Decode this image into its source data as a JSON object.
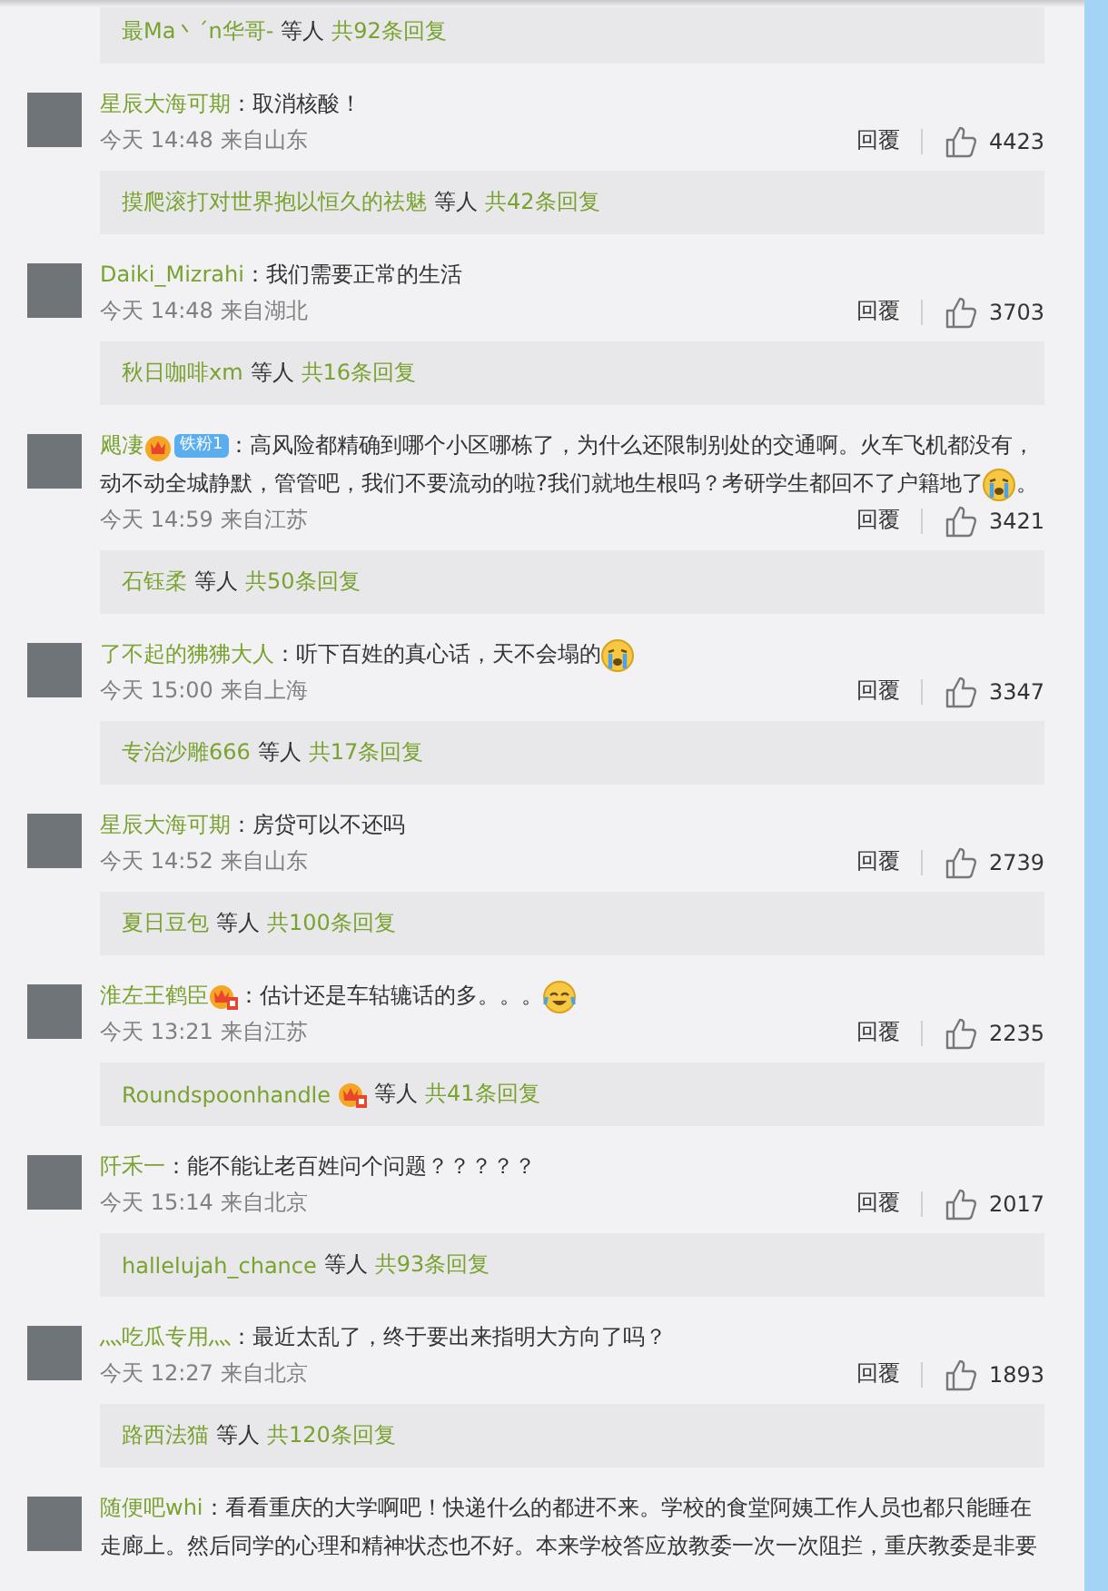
{
  "top_replies": {
    "names": "最Ma丶ˊn华哥-",
    "suffix": "等人",
    "count": "共92条回复"
  },
  "comments": [
    {
      "user": "星辰大海可期",
      "text": "：取消核酸！",
      "time": "今天 14:48",
      "source": "来自山东",
      "reply_label": "回覆",
      "likes": "4423",
      "replies": {
        "names": "摸爬滚打对世界抱以恒久的祛魅",
        "suffix": "等人",
        "count": "共42条回复"
      }
    },
    {
      "user": "Daiki_Mizrahi",
      "text": "：我们需要正常的生活",
      "time": "今天 14:48",
      "source": "来自湖北",
      "reply_label": "回覆",
      "likes": "3703",
      "replies": {
        "names": "秋日咖啡xm",
        "suffix": "等人",
        "count": "共16条回复"
      }
    },
    {
      "user": "飓凄",
      "badges": [
        {
          "kind": "crown"
        },
        {
          "kind": "fan",
          "label": "铁粉1"
        }
      ],
      "text": "：高风险都精确到哪个小区哪栋了，为什么还限制别处的交通啊。火车飞机都没有，",
      "more_lines": [
        "动不动全城静默，管管吧，我们不要流动的啦?我们就地生根吗？考研学生都回不了户籍地了"
      ],
      "emoji": {
        "kind": "crying"
      },
      "tail": "。",
      "time": "今天 14:59",
      "source": "来自江苏",
      "reply_label": "回覆",
      "likes": "3421",
      "replies": {
        "names": "石钰柔",
        "suffix": "等人",
        "count": "共50条回复"
      }
    },
    {
      "user": "了不起的狒狒大人",
      "text": "：听下百姓的真心话，天不会塌的",
      "emoji": {
        "kind": "crying"
      },
      "time": "今天 15:00",
      "source": "来自上海",
      "reply_label": "回覆",
      "likes": "3347",
      "replies": {
        "names": "专治沙雕666",
        "suffix": "等人",
        "count": "共17条回复"
      }
    },
    {
      "user": "星辰大海可期",
      "text": "：房贷可以不还吗",
      "time": "今天 14:52",
      "source": "来自山东",
      "reply_label": "回覆",
      "likes": "2739",
      "replies": {
        "names": "夏日豆包",
        "suffix": "等人",
        "count": "共100条回复"
      }
    },
    {
      "user": "淮左王鹤臣",
      "badges": [
        {
          "kind": "crown-tag"
        }
      ],
      "text": "：估计还是车轱辘话的多。。。",
      "emoji": {
        "kind": "laughing-crying"
      },
      "time": "今天 13:21",
      "source": "来自江苏",
      "reply_label": "回覆",
      "likes": "2235",
      "replies": {
        "names": "Roundspoonhandle",
        "badges": [
          {
            "kind": "crown-tag"
          }
        ],
        "suffix": "等人",
        "count": "共41条回复"
      }
    },
    {
      "user": "阡禾一",
      "text": "：能不能让老百姓问个问题？？？？？",
      "time": "今天 15:14",
      "source": "来自北京",
      "reply_label": "回覆",
      "likes": "2017",
      "replies": {
        "names": "hallelujah_chance",
        "suffix": "等人",
        "count": "共93条回复"
      }
    },
    {
      "user": "灬吃瓜专用灬",
      "text": "：最近太乱了，终于要出来指明大方向了吗？",
      "time": "今天 12:27",
      "source": "来自北京",
      "reply_label": "回覆",
      "likes": "1893",
      "replies": {
        "names": "路西法猫",
        "suffix": "等人",
        "count": "共120条回复"
      }
    },
    {
      "user": "随便吧whi",
      "text": "：看看重庆的大学啊吧！快递什么的都进不来。学校的食堂阿姨工作人员也都只能睡在",
      "more_lines": [
        "走廊上。然后同学的心理和精神状态也不好。本来学校答应放教委一次一次阻拦，重庆教委是非要"
      ]
    }
  ]
}
